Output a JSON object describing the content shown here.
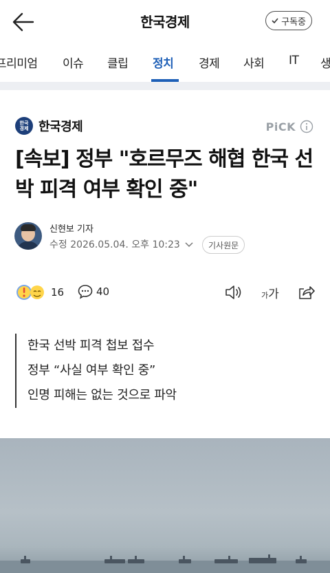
{
  "header": {
    "title": "한국경제",
    "subscribe_label": "구독중"
  },
  "tabs": [
    "프리미엄",
    "이슈",
    "클립",
    "정치",
    "경제",
    "사회",
    "IT",
    "생"
  ],
  "active_tab": "정치",
  "article": {
    "press_name": "한국경제",
    "press_logo_text": "한국\n경제",
    "pick_label": "PiCK",
    "headline": "[속보] 정부 \"호르무즈 해협 한국 선박 피격 여부 확인 중\"",
    "reporter": "신현보 기자",
    "published": "수정 2026.05.04. 오후 10:23",
    "original_label": "기사원문",
    "reaction_count": "16",
    "comment_count": "40",
    "font_small": "가",
    "font_big": "가",
    "summary": [
      "한국 선박 피격 첩보 접수",
      "정부 “사실 여부 확인 중”",
      "인명 피해는 없는 것으로 파악"
    ]
  },
  "colors": {
    "accent": "#1e5fb7",
    "pick": "#9aa0a6",
    "band": "#edeff3"
  }
}
